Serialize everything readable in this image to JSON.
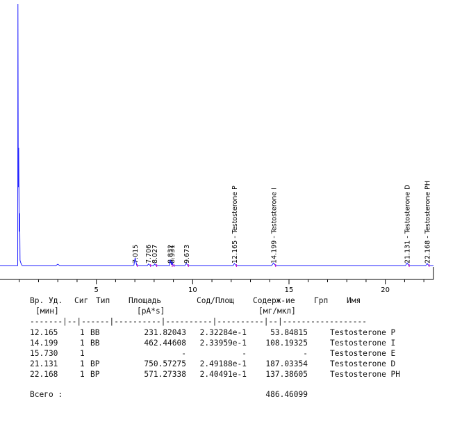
{
  "chart_data": {
    "type": "line",
    "x_range": [
      0,
      22.5
    ],
    "x_ticks": [
      "5",
      "10",
      "15",
      "20"
    ],
    "x_tick_values": [
      5,
      10,
      15,
      20
    ],
    "colors": {
      "trace": "#1f1fff",
      "axis": "#000000",
      "integration": "#cc00cc"
    },
    "trace": {
      "x": [
        0.9,
        0.92,
        0.93,
        0.95,
        0.97,
        1.0,
        1.02,
        1.04,
        1.08,
        1.15,
        2.0,
        2.9,
        3.0,
        3.1,
        6.8,
        6.95,
        7.015,
        7.1,
        7.65,
        7.706,
        7.8,
        7.98,
        8.027,
        8.1,
        8.8,
        8.832,
        8.9,
        8.93,
        8.98,
        9.0,
        9.6,
        9.673,
        9.75,
        12.1,
        12.165,
        12.25,
        14.1,
        14.199,
        14.3,
        21.05,
        21.131,
        21.22,
        22.1,
        22.168,
        22.25,
        22.5
      ],
      "y": [
        0,
        0,
        100,
        30,
        45,
        13,
        20,
        2,
        1,
        0,
        0,
        0,
        0.5,
        0,
        0,
        0.1,
        3.0,
        0,
        0,
        0.6,
        0,
        0,
        0.6,
        0,
        0,
        2.2,
        0.3,
        1.5,
        0.2,
        0,
        0,
        0.8,
        0,
        0,
        0.8,
        0,
        0,
        1.0,
        0,
        0,
        1.0,
        0,
        0,
        0.8,
        0,
        0
      ],
      "y_max": 100
    },
    "peaks": [
      {
        "rt": 7.015,
        "label": "7.015"
      },
      {
        "rt": 7.706,
        "label": "7.706"
      },
      {
        "rt": 8.027,
        "label": "8.027"
      },
      {
        "rt": 8.832,
        "label": "8.832"
      },
      {
        "rt": 8.931,
        "label": "8.931"
      },
      {
        "rt": 9.673,
        "label": "9.673"
      },
      {
        "rt": 12.165,
        "label": "12.165 - Testosterone P"
      },
      {
        "rt": 14.199,
        "label": "14.199 - Testosterone I"
      },
      {
        "rt": 21.131,
        "label": "21.131 - Testosterone D"
      },
      {
        "rt": 22.168,
        "label": "22.168 - Testosterone PH"
      }
    ]
  },
  "report": {
    "header1": [
      "Вр. Уд.",
      "Сиг",
      "Тип",
      "Площадь",
      "Сод/Площ",
      "Содерж-ие",
      "Грп",
      "Имя"
    ],
    "header2": [
      "[мин]",
      "[pA*s]",
      "[мг/мкл]"
    ],
    "separator": "-------|--|------|----------|----------|----------|--|------------------",
    "rows": [
      {
        "rt": "12.165",
        "sig": "1",
        "type": "BB",
        "area": "231.82043",
        "ratio": "2.32284e-1",
        "amount": "53.84815",
        "name": "Testosterone P"
      },
      {
        "rt": "14.199",
        "sig": "1",
        "type": "BB",
        "area": "462.44608",
        "ratio": "2.33959e-1",
        "amount": "108.19325",
        "name": "Testosterone I"
      },
      {
        "rt": "15.730",
        "sig": "1",
        "type": "",
        "area": "-",
        "ratio": "-",
        "amount": "-",
        "name": "Testosterone E"
      },
      {
        "rt": "21.131",
        "sig": "1",
        "type": "BP",
        "area": "750.57275",
        "ratio": "2.49188e-1",
        "amount": "187.03354",
        "name": "Testosterone D"
      },
      {
        "rt": "22.168",
        "sig": "1",
        "type": "BP",
        "area": "571.27338",
        "ratio": "2.40491e-1",
        "amount": "137.38605",
        "name": "Testosterone PH"
      }
    ],
    "total_label": "Всего :",
    "total_value": "486.46099"
  }
}
